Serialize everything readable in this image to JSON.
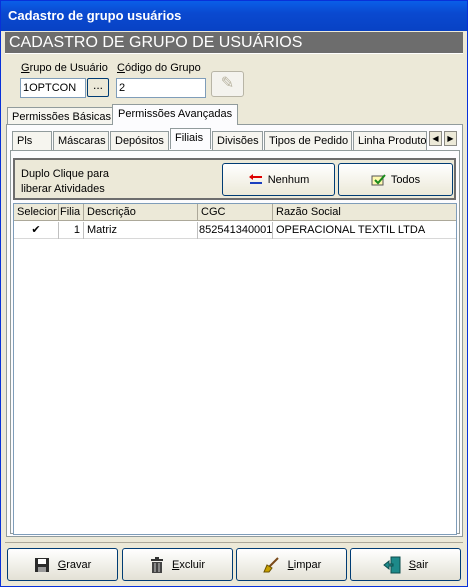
{
  "window": {
    "title": "Cadastro de grupo usuários"
  },
  "banner": {
    "text": "CADASTRO DE GRUPO DE USUÁRIOS"
  },
  "form": {
    "grupo_label_first": "G",
    "grupo_label_rest": "rupo de Usuário",
    "grupo_value": "1OPTCON",
    "ellipsis": "...",
    "codigo_label_first": "C",
    "codigo_label_rest": "ódigo do Grupo",
    "codigo_value": "2"
  },
  "outer_tabs": [
    "Permissões Básicas",
    "Permissões Avançadas"
  ],
  "inner_tabs": [
    "Pls",
    "Máscaras",
    "Depósitos",
    "Filiais",
    "Divisões",
    "Tipos de Pedido",
    "Linha Produto"
  ],
  "hint": {
    "line1": "Duplo Clique para",
    "line2": "liberar Atividades"
  },
  "actions": {
    "nenhum": "Nenhum",
    "todos": "Todos"
  },
  "grid": {
    "columns": [
      "Selecior",
      "Filia",
      "Descrição",
      "CGC",
      "Razão Social"
    ],
    "rows": [
      {
        "selected": "✔",
        "filial": "1",
        "descricao": "Matriz",
        "cgc": "852541340001",
        "razao": "OPERACIONAL TEXTIL LTDA"
      }
    ]
  },
  "bottom": {
    "gravar_first": "G",
    "gravar_rest": "ravar",
    "excluir_first": "E",
    "excluir_rest": "xcluir",
    "limpar_first": "L",
    "limpar_rest": "impar",
    "sair_first": "S",
    "sair_rest": "air"
  },
  "colors": {
    "titlebar": "#0a5fe8",
    "banner": "#6d6d6d",
    "face": "#ece9d8"
  }
}
